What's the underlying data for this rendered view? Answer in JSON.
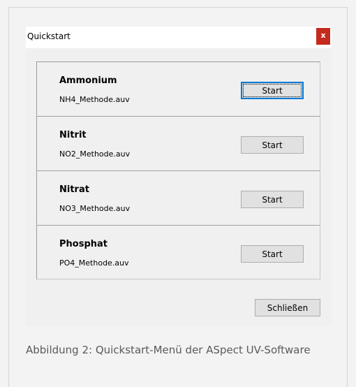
{
  "window": {
    "title": "Quickstart",
    "close_icon_label": "x"
  },
  "methods": [
    {
      "name": "Ammonium",
      "file": "NH4_Methode.auv",
      "button": "Start"
    },
    {
      "name": "Nitrit",
      "file": "NO2_Methode.auv",
      "button": "Start"
    },
    {
      "name": "Nitrat",
      "file": "NO3_Methode.auv",
      "button": "Start"
    },
    {
      "name": "Phosphat",
      "file": "PO4_Methode.auv",
      "button": "Start"
    }
  ],
  "footer": {
    "close_label": "Schließen"
  },
  "caption": "Abbildung 2: Quickstart-Menü der ASpect UV-Software",
  "colors": {
    "close_red": "#c42b1c",
    "focus_blue": "#0078d7"
  }
}
